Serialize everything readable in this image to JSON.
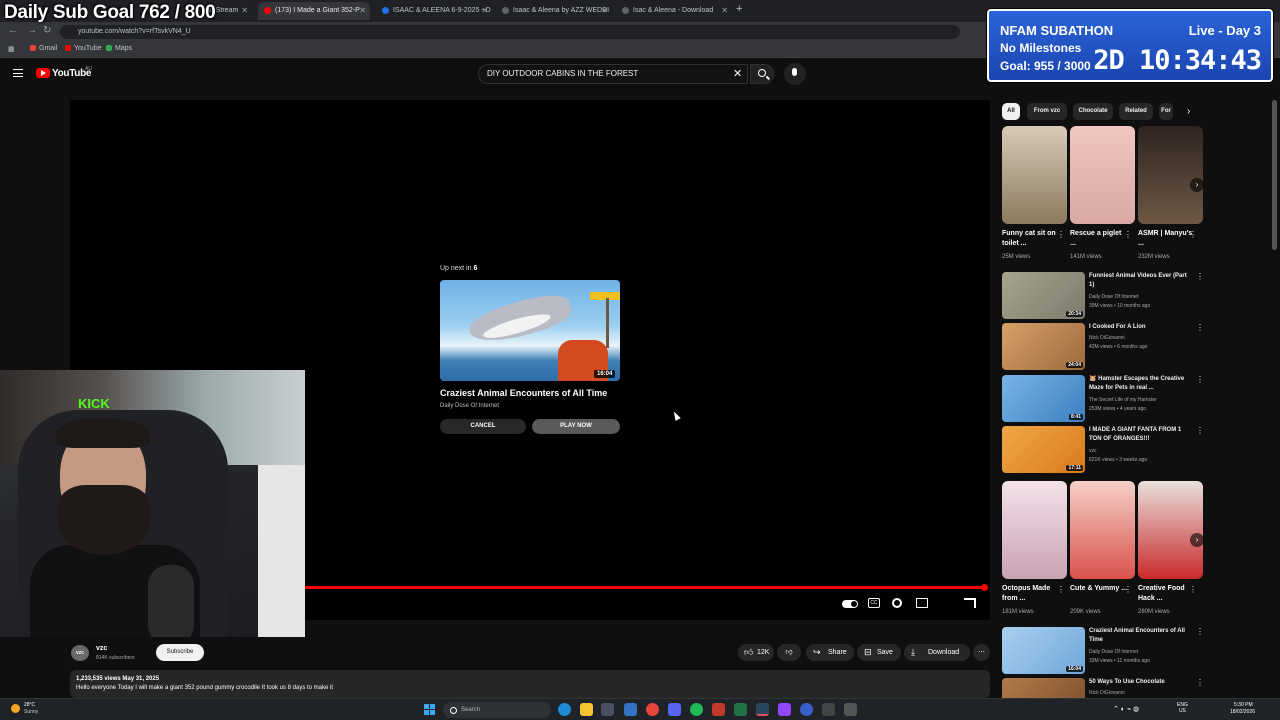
{
  "browser": {
    "tabs": [
      {
        "label": "(173) I Made a Giant 352-P",
        "active": true
      },
      {
        "label": "ISAAC & ALEENA 6-9-2025 - D",
        "active": false
      },
      {
        "label": "Isaac & Aleena by AZZ WEDDI",
        "active": false
      },
      {
        "label": "Isac & Aleena - Download",
        "active": false
      }
    ],
    "partial_tab_text": "nd Stream",
    "url": "youtube.com/watch?v=rfTsvkVN4_U",
    "bookmarks": [
      "Gmail",
      "YouTube",
      "Maps"
    ]
  },
  "overlay": {
    "sub_goal": "Daily Sub Goal  762 / 800",
    "subathon_title": "NFAM SUBATHON",
    "subathon_day": "Live - Day 3",
    "subathon_milestones": "No Milestones",
    "subathon_goal": "Goal: 955 / 3000",
    "subathon_timer": "2D 10:34:43",
    "webcam_sign": "KICK"
  },
  "youtube": {
    "wordmark": "YouTube",
    "region": "AU",
    "search_value": "DIY OUTDOOR CABINS IN THE FOREST"
  },
  "player": {
    "upnext_prefix": "Up next in",
    "upnext_countdown": "6",
    "upnext_title": "Craziest Animal Encounters of All Time",
    "upnext_channel": "Daily Dose Of Internet",
    "upnext_duration": "16:04",
    "cancel_label": "CANCEL",
    "play_now_label": "PLAY NOW",
    "progress_fraction": 0.995,
    "cc_label": "CC"
  },
  "video": {
    "channel_avatar": "vzc",
    "channel_name": "vzc",
    "channel_subs": "814K subscribers",
    "subscribe_label": "Subscribe",
    "likes": "12K",
    "share_label": "Share",
    "save_label": "Save",
    "download_label": "Download",
    "stats": "1,233,535 views  May 31, 2025",
    "description": "Hello everyone Today I will make a giant 352 pound gummy crocodile It took us 8 days to make it"
  },
  "sidebar": {
    "chips": [
      "All",
      "From vzc",
      "Chocolate",
      "Related",
      "For"
    ],
    "shorts_row1": [
      {
        "title": "Funny cat sit on toilet ...",
        "views": "25M views",
        "color": "#8a7a5e"
      },
      {
        "title": "Rescue a piglet ...",
        "views": "141M views",
        "color": "#d9a8a4"
      },
      {
        "title": "ASMR | Manyu's ...",
        "views": "232M views",
        "color": "#6e5844"
      }
    ],
    "videos_row1": [
      {
        "title": "Funniest Animal Videos Ever (Part 1)",
        "channel": "Daily Dose Of Internet",
        "meta": "39M views • 10 months ago",
        "duration": "20:34",
        "color": "#7c7a6a"
      },
      {
        "title": "I Cooked For A Lion",
        "channel": "Nick DiGiovanni",
        "meta": "42M views • 6 months ago",
        "duration": "24:04",
        "color": "#9c6a3e"
      },
      {
        "title": "🐹 Hamster Escapes the Creative Maze for Pets in real ...",
        "channel": "The Secret Life of my Hamster",
        "meta": "253M views • 4 years ago",
        "duration": "8:41",
        "color": "#3a7fc0"
      },
      {
        "title": "I MADE A GIANT FANTA FROM 1 TON OF ORANGES!!!",
        "channel": "vzc",
        "meta": "621K views • 3 weeks ago",
        "duration": "17:11",
        "color": "#d97a1c"
      }
    ],
    "shorts_row2": [
      {
        "title": "Octopus Made from ...",
        "views": "181M views",
        "color": "#c9a2b4"
      },
      {
        "title": "Cute & Yummy ...",
        "views": "209K views",
        "color": "#d9524a"
      },
      {
        "title": "Creative Food Hack ...",
        "views": "280M views",
        "color": "#c92a2a"
      }
    ],
    "videos_row2": [
      {
        "title": "Craziest Animal Encounters of All Time",
        "channel": "Daily Dose Of Internet",
        "meta": "33M views • 11 months ago",
        "duration": "16:04",
        "color": "#6fa6d8"
      },
      {
        "title": "50 Ways To Use Chocolate",
        "channel": "Nick DiGiovanni",
        "meta": "",
        "duration": "",
        "color": "#7a4a2a"
      }
    ]
  },
  "taskbar": {
    "temp": "28°C",
    "condition": "Sunny",
    "search_placeholder": "Search",
    "lang": "ENG",
    "region": "US",
    "time": "5:30 PM",
    "date": "18/02/2026"
  }
}
